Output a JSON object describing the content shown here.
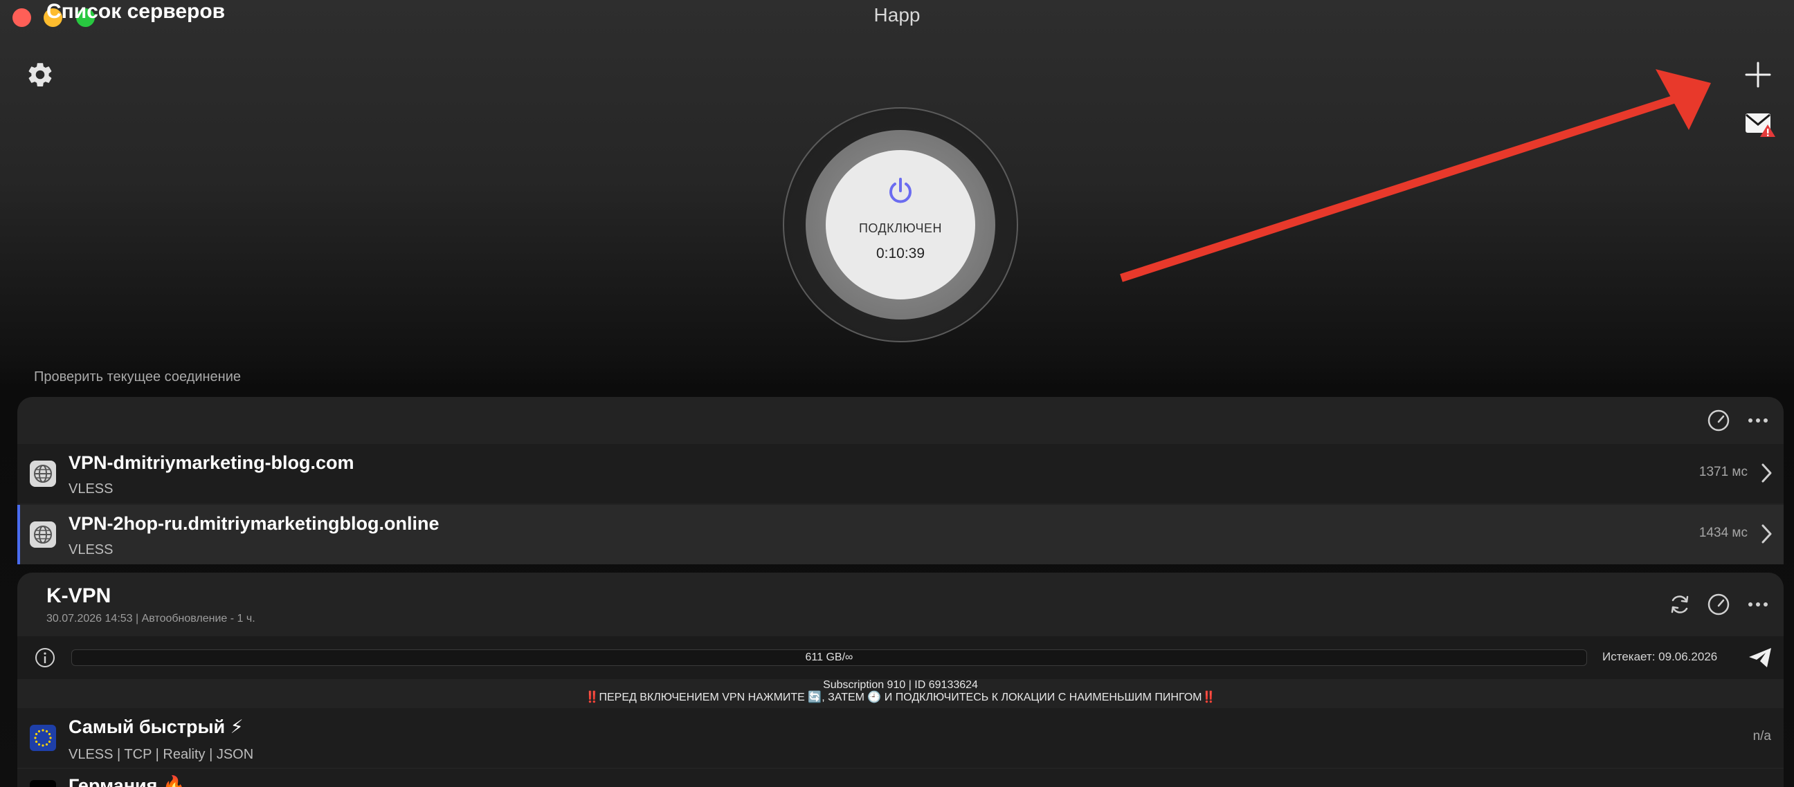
{
  "window": {
    "title": "Happ"
  },
  "connection": {
    "status": "ПОДКЛЮЧЕН",
    "timer": "0:10:39",
    "check_link": "Проверить текущее соединение",
    "accent_color": "#6b6cf0"
  },
  "server_list": {
    "title": "Список серверов",
    "servers": [
      {
        "name": "VPN-dmitriymarketing-blog.com",
        "protocol": "VLESS",
        "ping": "1371 мс",
        "selected": false
      },
      {
        "name": "VPN-2hop-ru.dmitriymarketingblog.online",
        "protocol": "VLESS",
        "ping": "1434 мс",
        "selected": true
      }
    ]
  },
  "subscription": {
    "title": "K-VPN",
    "meta": "30.07.2026 14:53 | Автообновление - 1 ч.",
    "traffic": "611 GB/∞",
    "expires": "Истекает: 09.06.2026",
    "announcement_line1": "Subscription 910 | ID 69133624",
    "announcement_warn_left": "‼️",
    "announcement_line2": "ПЕРЕД ВКЛЮЧЕНИЕМ VPN НАЖМИТЕ 🔄, ЗАТЕМ 🕘 И ПОДКЛЮЧИТЕСЬ К ЛОКАЦИИ С НАИМЕНЬШИМ ПИНГОМ",
    "announcement_warn_right": "‼️",
    "locations": [
      {
        "name": "Самый быстрый ⚡",
        "protocol": "VLESS | TCP | Reality | JSON",
        "ping": "n/a"
      },
      {
        "name": "Германия 🔥"
      }
    ]
  },
  "icons": {
    "settings": "gear-icon",
    "add": "plus-icon",
    "mail_alert": "mail-alert-icon",
    "speed": "speedometer-icon",
    "more": "more-icon",
    "refresh": "refresh-icon",
    "info": "info-icon",
    "telegram": "telegram-icon"
  }
}
